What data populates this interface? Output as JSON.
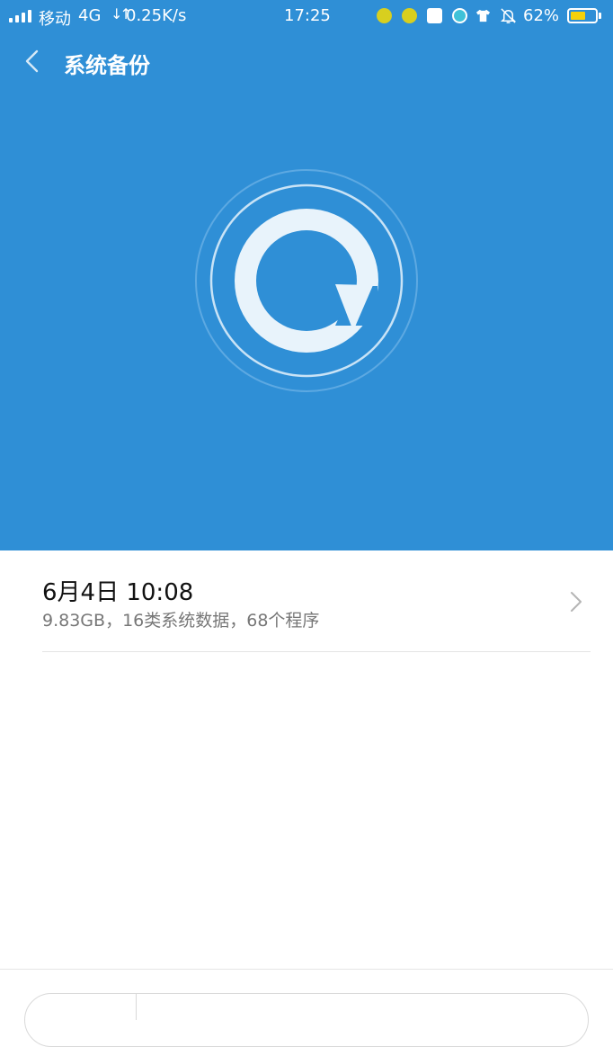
{
  "status_bar": {
    "carrier": "移动",
    "network": "4G",
    "net_arrows": "↓↑",
    "speed": "0.25K/s",
    "time": "17:25",
    "battery_percent": "62%",
    "battery_level": 0.62,
    "notification_icons": [
      "app-notification-icon",
      "app-notification-icon",
      "message-icon",
      "browser-icon",
      "tshirt-icon",
      "bell-off-icon"
    ]
  },
  "header": {
    "title": "系统备份",
    "back_icon": "chevron-left-icon"
  },
  "hero": {
    "background": "#2f8fd6",
    "logo_icon": "backup-restore-icon"
  },
  "backups": [
    {
      "date": "6月4日 10:08",
      "details": "9.83GB，16类系统数据，68个程序"
    }
  ]
}
